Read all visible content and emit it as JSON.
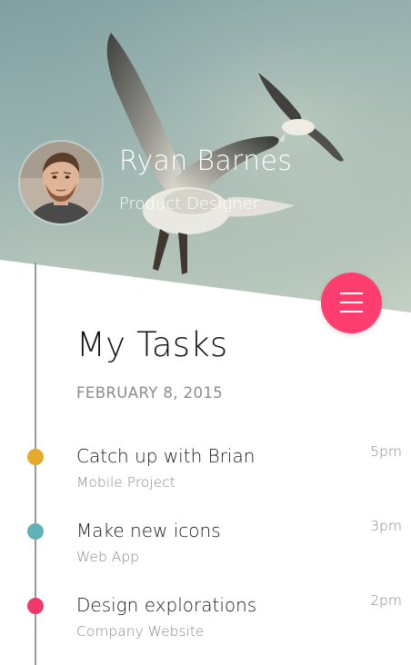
{
  "profile": {
    "name": "Ryan Barnes",
    "role": "Product Designer",
    "avatar_icon": "avatar-photo"
  },
  "menu": {
    "icon": "hamburger-menu-icon",
    "color": "#ff3d6e"
  },
  "tasks_section": {
    "title": "My Tasks",
    "date": "FEBRUARY 8, 2015"
  },
  "tasks": [
    {
      "title": "Catch up with Brian",
      "subtitle": "Mobile Project",
      "time": "5pm",
      "color": "#e5a92b"
    },
    {
      "title": "Make new icons",
      "subtitle": "Web App",
      "time": "3pm",
      "color": "#5fb3b8"
    },
    {
      "title": "Design explorations",
      "subtitle": "Company Website",
      "time": "2pm",
      "color": "#f0396a"
    }
  ]
}
